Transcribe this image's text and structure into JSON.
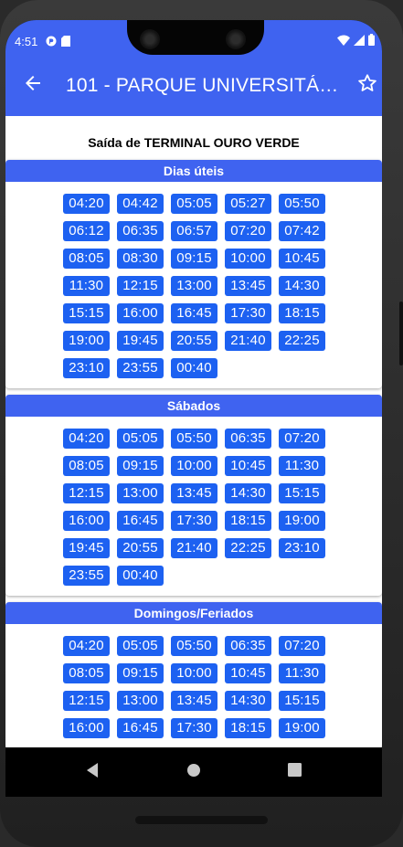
{
  "status_bar": {
    "time": "4:51",
    "left_icons": [
      "app-notification-icon",
      "sd-card-icon"
    ],
    "right_icons": [
      "wifi-icon",
      "signal-icon",
      "battery-icon"
    ]
  },
  "appbar": {
    "title": "101 - PARQUE UNIVERSITÁRIO...",
    "back_icon": "arrow-left-icon",
    "favorite_icon": "star-outline-icon"
  },
  "subtitle": "Saída de TERMINAL OURO VERDE",
  "colors": {
    "accent": "#3f63f0",
    "chip": "#1d61f1",
    "background": "#ffffff"
  },
  "sections": [
    {
      "title": "Dias úteis",
      "times": [
        "04:20",
        "04:42",
        "05:05",
        "05:27",
        "05:50",
        "06:12",
        "06:35",
        "06:57",
        "07:20",
        "07:42",
        "08:05",
        "08:30",
        "09:15",
        "10:00",
        "10:45",
        "11:30",
        "12:15",
        "13:00",
        "13:45",
        "14:30",
        "15:15",
        "16:00",
        "16:45",
        "17:30",
        "18:15",
        "19:00",
        "19:45",
        "20:55",
        "21:40",
        "22:25",
        "23:10",
        "23:55",
        "00:40"
      ]
    },
    {
      "title": "Sábados",
      "times": [
        "04:20",
        "05:05",
        "05:50",
        "06:35",
        "07:20",
        "08:05",
        "09:15",
        "10:00",
        "10:45",
        "11:30",
        "12:15",
        "13:00",
        "13:45",
        "14:30",
        "15:15",
        "16:00",
        "16:45",
        "17:30",
        "18:15",
        "19:00",
        "19:45",
        "20:55",
        "21:40",
        "22:25",
        "23:10",
        "23:55",
        "00:40"
      ]
    },
    {
      "title": "Domingos/Feriados",
      "times": [
        "04:20",
        "05:05",
        "05:50",
        "06:35",
        "07:20",
        "08:05",
        "09:15",
        "10:00",
        "10:45",
        "11:30",
        "12:15",
        "13:00",
        "13:45",
        "14:30",
        "15:15",
        "16:00",
        "16:45",
        "17:30",
        "18:15",
        "19:00"
      ]
    }
  ],
  "nav_bar": {
    "icons": [
      "nav-back-icon",
      "nav-home-icon",
      "nav-recents-icon"
    ]
  }
}
